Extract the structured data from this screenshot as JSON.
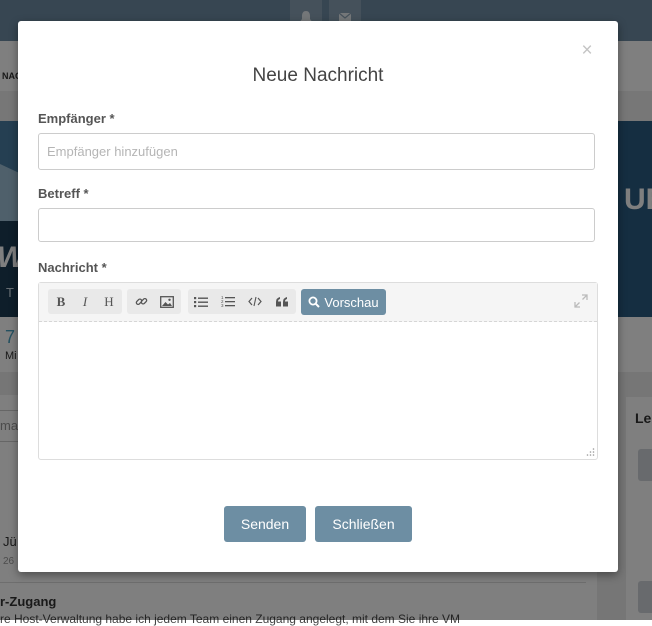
{
  "background": {
    "nav_text": "NAC",
    "banner_text_w": "W",
    "banner_text_d": "T D",
    "banner_right_text": "UE",
    "stats_number": "7",
    "stats_label": "Mi",
    "search_placeholder": "ma",
    "row_name": "Jü",
    "row_date": "26",
    "post_title": "r-Zugang",
    "post_text": "re Host-Verwaltung habe ich jedem Team einen Zugang angelegt, mit dem Sie ihre VM",
    "side_heading": "Le"
  },
  "modal": {
    "title": "Neue Nachricht",
    "close_glyph": "×",
    "recipient_label": "Empfänger *",
    "recipient_placeholder": "Empfänger hinzufügen",
    "recipient_value": "",
    "subject_label": "Betreff *",
    "subject_value": "",
    "message_label": "Nachricht *",
    "toolbar": {
      "bold": "B",
      "italic": "I",
      "heading": "H",
      "preview": "Vorschau"
    },
    "send_button": "Senden",
    "close_button": "Schließen"
  },
  "colors": {
    "accent": "#6d8ea3",
    "topbar": "#6f8da4"
  }
}
